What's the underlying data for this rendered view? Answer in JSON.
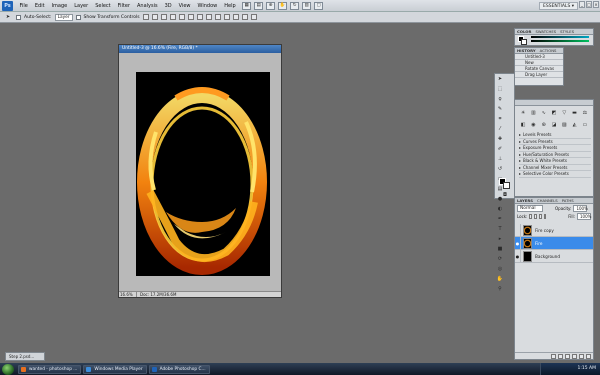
{
  "menubar": {
    "logo": "Ps",
    "items": [
      "File",
      "Edit",
      "Image",
      "Layer",
      "Select",
      "Filter",
      "Analysis",
      "3D",
      "View",
      "Window",
      "Help"
    ],
    "workspace": "ESSENTIALS ▾"
  },
  "options": {
    "autoselect_label": "Auto-Select:",
    "autoselect_value": "Layer",
    "transform_label": "Show Transform Controls"
  },
  "document": {
    "title": "Untitled-3 @ 16.6% (Fire, RGB/8) *",
    "zoom": "16.6%",
    "info": "Doc: 17.2M/36.6M"
  },
  "color_panel": {
    "tabs": [
      "COLOR",
      "SWATCHES",
      "STYLES"
    ]
  },
  "history_panel": {
    "tabs": [
      "HISTORY",
      "ACTIONS"
    ],
    "items": [
      "Untitled-3",
      "New",
      "Rotate Canvas",
      "Drag Layer"
    ]
  },
  "adjustments_panel": {
    "items": [
      "Levels Presets",
      "Curves Presets",
      "Exposure Presets",
      "Hue/Saturation Presets",
      "Black & White Presets",
      "Channel Mixer Presets",
      "Selective Color Presets"
    ]
  },
  "layers_panel": {
    "tabs": [
      "LAYERS",
      "CHANNELS",
      "PATHS"
    ],
    "blend": "Normal",
    "opacity_label": "Opacity:",
    "opacity": "100%",
    "lock_label": "Lock:",
    "fill_label": "Fill:",
    "fill": "100%",
    "layers": [
      {
        "name": "Fire copy",
        "visible": false,
        "selected": false
      },
      {
        "name": "Fire",
        "visible": true,
        "selected": true
      },
      {
        "name": "Background",
        "visible": true,
        "selected": false
      }
    ]
  },
  "minimized_doc": "Step 2.psd...",
  "taskbar": {
    "buttons": [
      "wanted - photoshop ...",
      "Windows Media Player",
      "Adobe Photoshop C..."
    ],
    "time": "1:15 AM"
  }
}
